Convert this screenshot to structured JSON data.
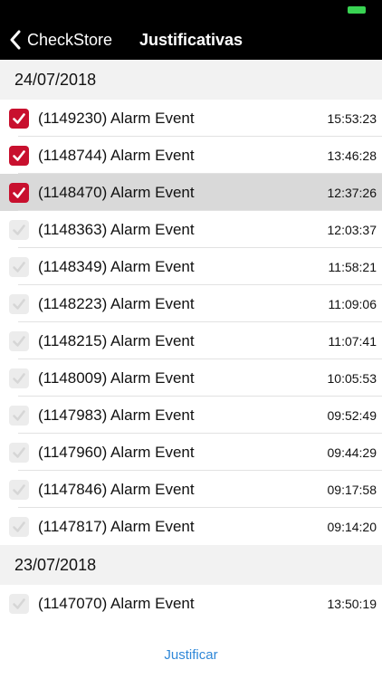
{
  "nav": {
    "back_label": "CheckStore",
    "title": "Justificativas"
  },
  "sections": [
    {
      "date": "24/07/2018",
      "rows": [
        {
          "label": "(1149230)  Alarm Event",
          "time": "15:53:23",
          "checked": true,
          "selected": false
        },
        {
          "label": "(1148744)  Alarm Event",
          "time": "13:46:28",
          "checked": true,
          "selected": false
        },
        {
          "label": "(1148470)  Alarm Event",
          "time": "12:37:26",
          "checked": true,
          "selected": true
        },
        {
          "label": "(1148363)  Alarm Event",
          "time": "12:03:37",
          "checked": false,
          "selected": false
        },
        {
          "label": "(1148349)  Alarm Event",
          "time": "11:58:21",
          "checked": false,
          "selected": false
        },
        {
          "label": "(1148223)  Alarm Event",
          "time": "11:09:06",
          "checked": false,
          "selected": false
        },
        {
          "label": "(1148215)  Alarm Event",
          "time": "11:07:41",
          "checked": false,
          "selected": false
        },
        {
          "label": "(1148009)  Alarm Event",
          "time": "10:05:53",
          "checked": false,
          "selected": false
        },
        {
          "label": "(1147983)  Alarm Event",
          "time": "09:52:49",
          "checked": false,
          "selected": false
        },
        {
          "label": "(1147960)  Alarm Event",
          "time": "09:44:29",
          "checked": false,
          "selected": false
        },
        {
          "label": "(1147846)  Alarm Event",
          "time": "09:17:58",
          "checked": false,
          "selected": false
        },
        {
          "label": "(1147817)  Alarm Event",
          "time": "09:14:20",
          "checked": false,
          "selected": false
        }
      ]
    },
    {
      "date": "23/07/2018",
      "rows": [
        {
          "label": "(1147070)  Alarm Event",
          "time": "13:50:19",
          "checked": false,
          "selected": false
        }
      ]
    }
  ],
  "footer": {
    "button_label": "Justificar"
  },
  "colors": {
    "checked": "#c8102e",
    "unchecked": "#ececec",
    "accent": "#2f88d8"
  },
  "icons": {
    "back": "chevron-left-icon",
    "check": "checkmark-icon",
    "battery": "battery-icon"
  }
}
